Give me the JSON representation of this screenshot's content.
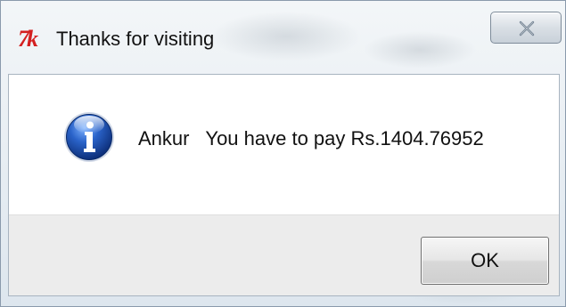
{
  "window": {
    "title": "Thanks for visiting",
    "app_icon_glyph": "7k",
    "app_icon_name": "tk-feather-icon"
  },
  "dialog": {
    "icon": "info-icon",
    "message": "Ankur   You have to pay Rs.1404.76952"
  },
  "buttons": {
    "ok_label": "OK",
    "close_icon": "close-icon"
  },
  "colors": {
    "app_icon": "#d42020",
    "info_icon_fill": "#1f4fb0"
  }
}
